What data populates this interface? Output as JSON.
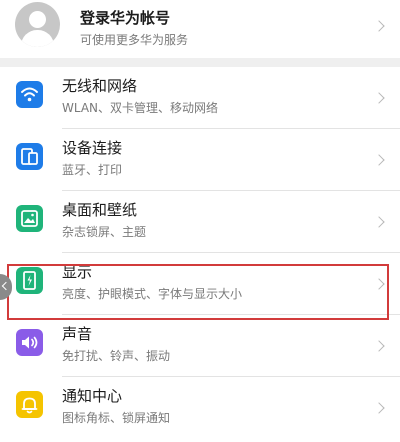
{
  "account": {
    "title": "登录华为帐号",
    "subtitle": "可使用更多华为服务"
  },
  "settings": [
    {
      "label": "无线和网络",
      "desc": "WLAN、双卡管理、移动网络",
      "icon": "wifi-icon",
      "color": "#1e7ce8"
    },
    {
      "label": "设备连接",
      "desc": "蓝牙、打印",
      "icon": "device-connection-icon",
      "color": "#1e7ce8"
    },
    {
      "label": "桌面和壁纸",
      "desc": "杂志锁屏、主题",
      "icon": "wallpaper-icon",
      "color": "#1fb47a"
    },
    {
      "label": "显示",
      "desc": "亮度、护眼模式、字体与显示大小",
      "icon": "display-icon",
      "color": "#1fb47a"
    },
    {
      "label": "声音",
      "desc": "免打扰、铃声、振动",
      "icon": "sound-icon",
      "color": "#8a5ce8"
    },
    {
      "label": "通知中心",
      "desc": "图标角标、锁屏通知",
      "icon": "notification-icon",
      "color": "#f5c400"
    }
  ],
  "highlight_color": "#d23b3b"
}
